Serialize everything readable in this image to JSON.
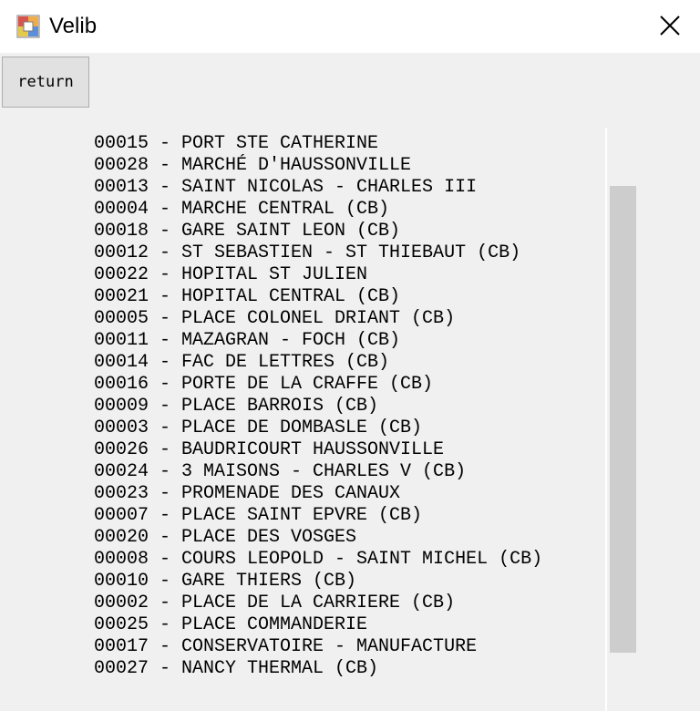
{
  "window": {
    "title": "Velib",
    "app_icon": "app-window-icon",
    "close_icon": "close-icon"
  },
  "toolbar": {
    "return_label": "return"
  },
  "stations": [
    "00015 - PORT STE CATHERINE",
    "00028 - MARCHÉ D'HAUSSONVILLE",
    "00013 - SAINT NICOLAS - CHARLES III",
    "00004 - MARCHE CENTRAL (CB)",
    "00018 - GARE SAINT LEON (CB)",
    "00012 - ST SEBASTIEN - ST THIEBAUT (CB)",
    "00022 - HOPITAL ST JULIEN",
    "00021 - HOPITAL CENTRAL (CB)",
    "00005 - PLACE COLONEL DRIANT (CB)",
    "00011 - MAZAGRAN - FOCH (CB)",
    "00014 - FAC DE LETTRES (CB)",
    "00016 - PORTE DE LA CRAFFE (CB)",
    "00009 - PLACE BARROIS (CB)",
    "00003 - PLACE DE DOMBASLE (CB)",
    "00026 - BAUDRICOURT HAUSSONVILLE",
    "00024 - 3 MAISONS - CHARLES V (CB)",
    "00023 - PROMENADE DES CANAUX",
    "00007 - PLACE SAINT EPVRE (CB)",
    "00020 - PLACE DES VOSGES",
    "00008 - COURS LEOPOLD - SAINT MICHEL (CB)",
    "00010 - GARE THIERS (CB)",
    "00002 - PLACE DE LA CARRIERE (CB)",
    "00025 - PLACE COMMANDERIE",
    "00017 - CONSERVATOIRE - MANUFACTURE",
    "00027 - NANCY THERMAL (CB)"
  ]
}
